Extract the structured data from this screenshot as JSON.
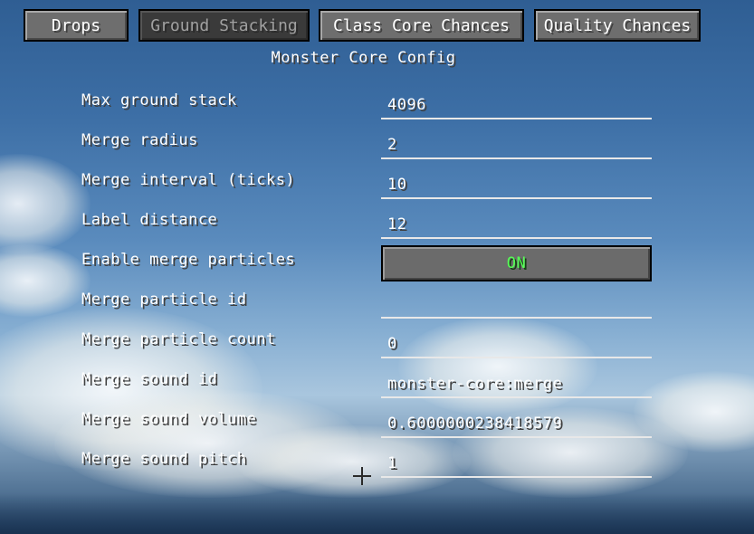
{
  "tabs": [
    {
      "label": "Drops",
      "active": false
    },
    {
      "label": "Ground Stacking",
      "active": true
    },
    {
      "label": "Class Core Chances",
      "active": false
    },
    {
      "label": "Quality Chances",
      "active": false
    }
  ],
  "title": "Monster Core Config",
  "rows": [
    {
      "label": "Max ground stack",
      "value": "4096"
    },
    {
      "label": "Merge radius",
      "value": "2"
    },
    {
      "label": "Merge interval (ticks)",
      "value": "10"
    },
    {
      "label": "Label distance",
      "value": "12"
    },
    {
      "label": "Enable merge particles",
      "value": "ON"
    },
    {
      "label": "Merge particle id",
      "value": ""
    },
    {
      "label": "Merge particle count",
      "value": "0"
    },
    {
      "label": "Merge sound id",
      "value": "monster-core:merge"
    },
    {
      "label": "Merge sound volume",
      "value": "0.6000000238418579"
    },
    {
      "label": "Merge sound pitch",
      "value": "1"
    }
  ],
  "colors": {
    "toggle_on_text": "#55ff55",
    "inactive_tab_text": "#a0a0a0",
    "text": "#ffffff"
  },
  "icons": {
    "crosshair": "crosshair-icon"
  }
}
